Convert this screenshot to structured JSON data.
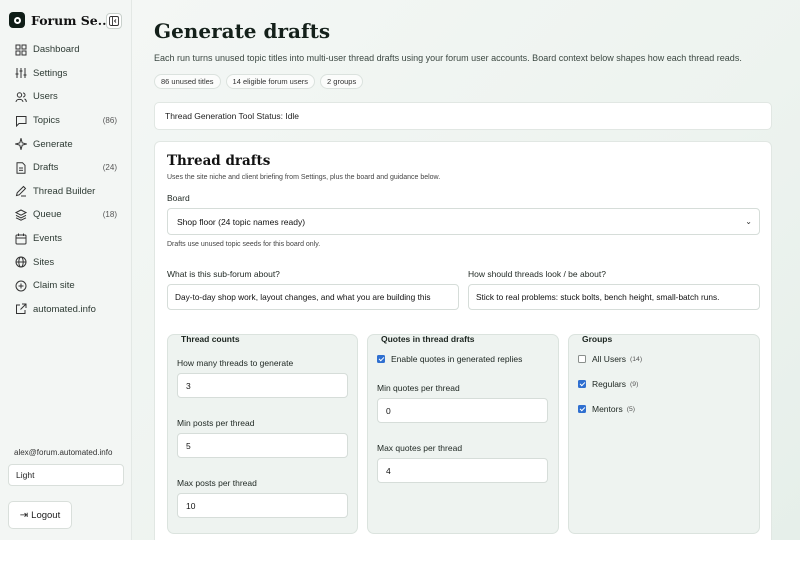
{
  "sidebar": {
    "brand": "Forum Se...",
    "items": [
      {
        "label": "Dashboard",
        "icon": "dashboard-icon",
        "count": ""
      },
      {
        "label": "Settings",
        "icon": "sliders-icon",
        "count": ""
      },
      {
        "label": "Users",
        "icon": "users-icon",
        "count": ""
      },
      {
        "label": "Topics",
        "icon": "chat-bubble-icon",
        "count": "(86)"
      },
      {
        "label": "Generate",
        "icon": "sparkle-icon",
        "count": ""
      },
      {
        "label": "Drafts",
        "icon": "document-icon",
        "count": "(24)"
      },
      {
        "label": "Thread Builder",
        "icon": "pen-icon",
        "count": ""
      },
      {
        "label": "Queue",
        "icon": "layers-icon",
        "count": "(18)"
      },
      {
        "label": "Events",
        "icon": "calendar-icon",
        "count": ""
      },
      {
        "label": "Sites",
        "icon": "globe-icon",
        "count": ""
      },
      {
        "label": "Claim site",
        "icon": "plus-circle-icon",
        "count": ""
      },
      {
        "label": "automated.info",
        "icon": "external-link-icon",
        "count": ""
      }
    ],
    "user_email": "alex@forum.automated.info",
    "theme": "Light",
    "logout": "Logout"
  },
  "header": {
    "title": "Generate drafts",
    "subtitle": "Each run turns unused topic titles into multi-user thread drafts using your forum user accounts. Board context below shapes how each thread reads.",
    "chips": [
      "86 unused titles",
      "14 eligible forum users",
      "2 groups"
    ]
  },
  "status": "Thread Generation Tool Status: Idle",
  "form": {
    "title": "Thread drafts",
    "subtitle": "Uses the site niche and client briefing from Settings, plus the board and guidance below.",
    "board_label": "Board",
    "board_value": "Shop floor (24 topic names ready)",
    "board_hint": "Drafts use unused topic seeds for this board only.",
    "about_label": "What is this sub-forum about?",
    "about_value": "Day-to-day shop work, layout changes, and what you are building this",
    "look_label": "How should threads look / be about?",
    "look_value": "Stick to real problems: stuck bolts, bench height, small-batch runs.",
    "counts": {
      "title": "Thread counts",
      "threads_label": "How many threads to generate",
      "threads_value": "3",
      "min_posts_label": "Min posts per thread",
      "min_posts_value": "5",
      "max_posts_label": "Max posts per thread",
      "max_posts_value": "10"
    },
    "quotes": {
      "title": "Quotes in thread drafts",
      "enable_label": "Enable quotes in generated replies",
      "enabled": true,
      "min_label": "Min quotes per thread",
      "min_value": "0",
      "max_label": "Max quotes per thread",
      "max_value": "4"
    },
    "groups": {
      "title": "Groups",
      "items": [
        {
          "label": "All Users",
          "count": "(14)",
          "checked": false
        },
        {
          "label": "Regulars",
          "count": "(9)",
          "checked": true
        },
        {
          "label": "Mentors",
          "count": "(5)",
          "checked": true
        }
      ]
    }
  }
}
